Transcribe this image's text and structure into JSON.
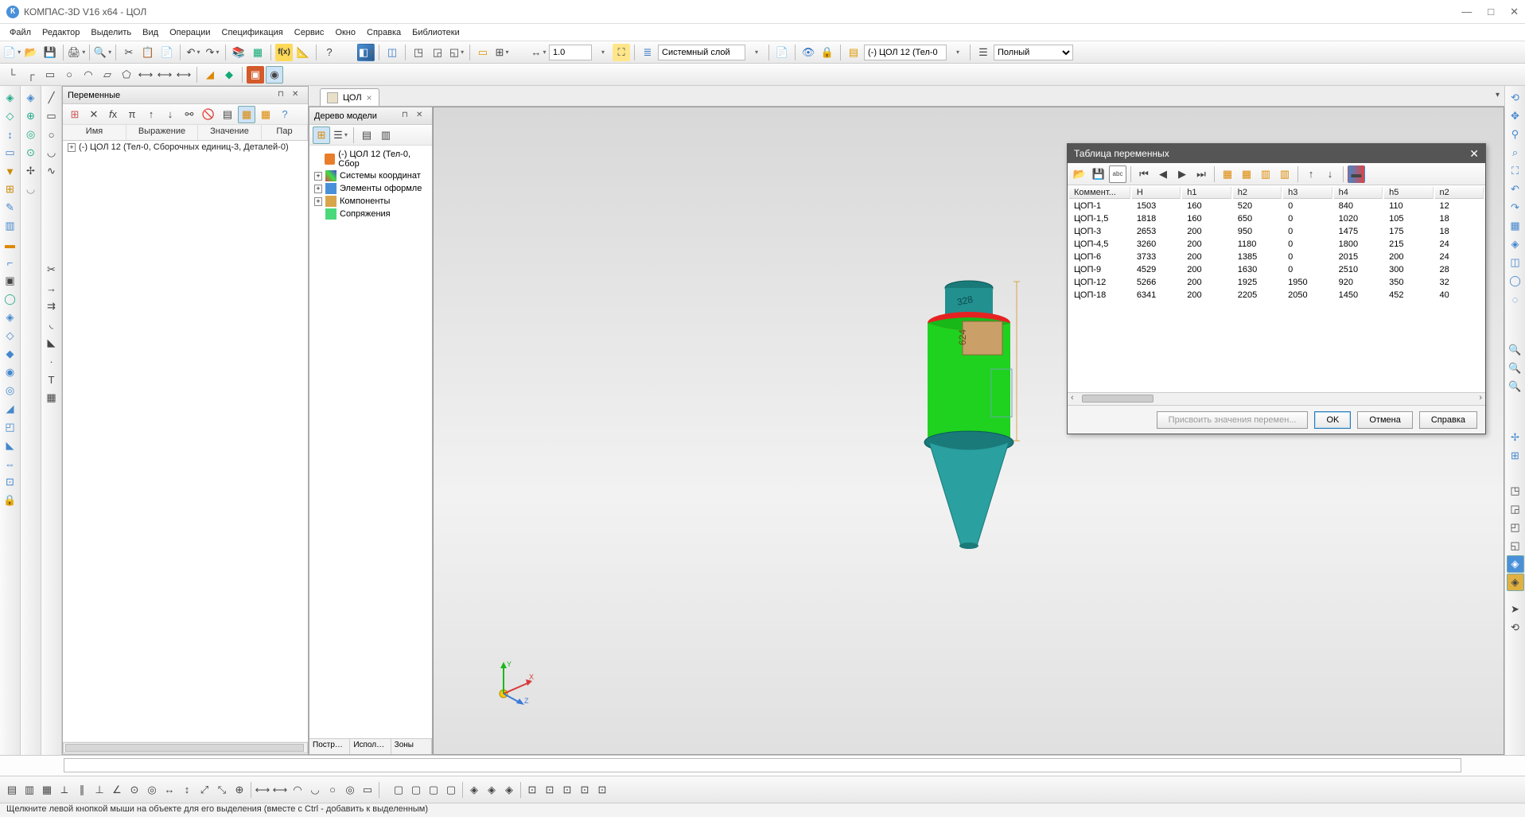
{
  "app_title": "КОМПАС-3D V16  x64 - ЦОЛ",
  "menu": [
    "Файл",
    "Редактор",
    "Выделить",
    "Вид",
    "Операции",
    "Спецификация",
    "Сервис",
    "Окно",
    "Справка",
    "Библиотеки"
  ],
  "toolbar1": {
    "scale_value": "1.0",
    "layer_value": "Системный слой",
    "doc_value": "(-) ЦОЛ 12 (Тел-0",
    "view_mode": "Полный"
  },
  "panel_variables": {
    "title": "Переменные",
    "headers": [
      "Имя",
      "Выражение",
      "Значение",
      "Пар"
    ],
    "root": "(-) ЦОЛ 12 (Тел-0, Сборочных единиц-3, Деталей-0)"
  },
  "doc_tab": {
    "label": "ЦОЛ"
  },
  "model_tree": {
    "title": "Дерево модели",
    "root": "(-) ЦОЛ 12 (Тел-0, Сбор",
    "nodes": [
      "Системы координат",
      "Элементы оформле",
      "Компоненты",
      "Сопряжения"
    ],
    "tabs": [
      "Построе...",
      "Исполне...",
      "Зоны"
    ]
  },
  "axes": {
    "x": "X",
    "y": "Y",
    "z": "Z"
  },
  "model_annotation": {
    "a": "328",
    "b": "624"
  },
  "dialog": {
    "title": "Таблица переменных",
    "headers": [
      "Коммент...",
      "H",
      "h1",
      "h2",
      "h3",
      "h4",
      "h5",
      "n2"
    ],
    "rows": [
      [
        "ЦОП-1",
        "1503",
        "160",
        "520",
        "0",
        "840",
        "110",
        "12"
      ],
      [
        "ЦОП-1,5",
        "1818",
        "160",
        "650",
        "0",
        "1020",
        "105",
        "18"
      ],
      [
        "ЦОП-3",
        "2653",
        "200",
        "950",
        "0",
        "1475",
        "175",
        "18"
      ],
      [
        "ЦОП-4,5",
        "3260",
        "200",
        "1180",
        "0",
        "1800",
        "215",
        "24"
      ],
      [
        "ЦОП-6",
        "3733",
        "200",
        "1385",
        "0",
        "2015",
        "200",
        "24"
      ],
      [
        "ЦОП-9",
        "4529",
        "200",
        "1630",
        "0",
        "2510",
        "300",
        "28"
      ],
      [
        "ЦОП-12",
        "5266",
        "200",
        "1925",
        "1950",
        "920",
        "350",
        "32"
      ],
      [
        "ЦОП-18",
        "6341",
        "200",
        "2205",
        "2050",
        "1450",
        "452",
        "40"
      ]
    ],
    "btn_assign": "Присвоить значения перемен...",
    "btn_ok": "OK",
    "btn_cancel": "Отмена",
    "btn_help": "Справка"
  },
  "statusbar": "Щелкните левой кнопкой мыши на объекте для его выделения (вместе с Ctrl - добавить к выделенным)"
}
